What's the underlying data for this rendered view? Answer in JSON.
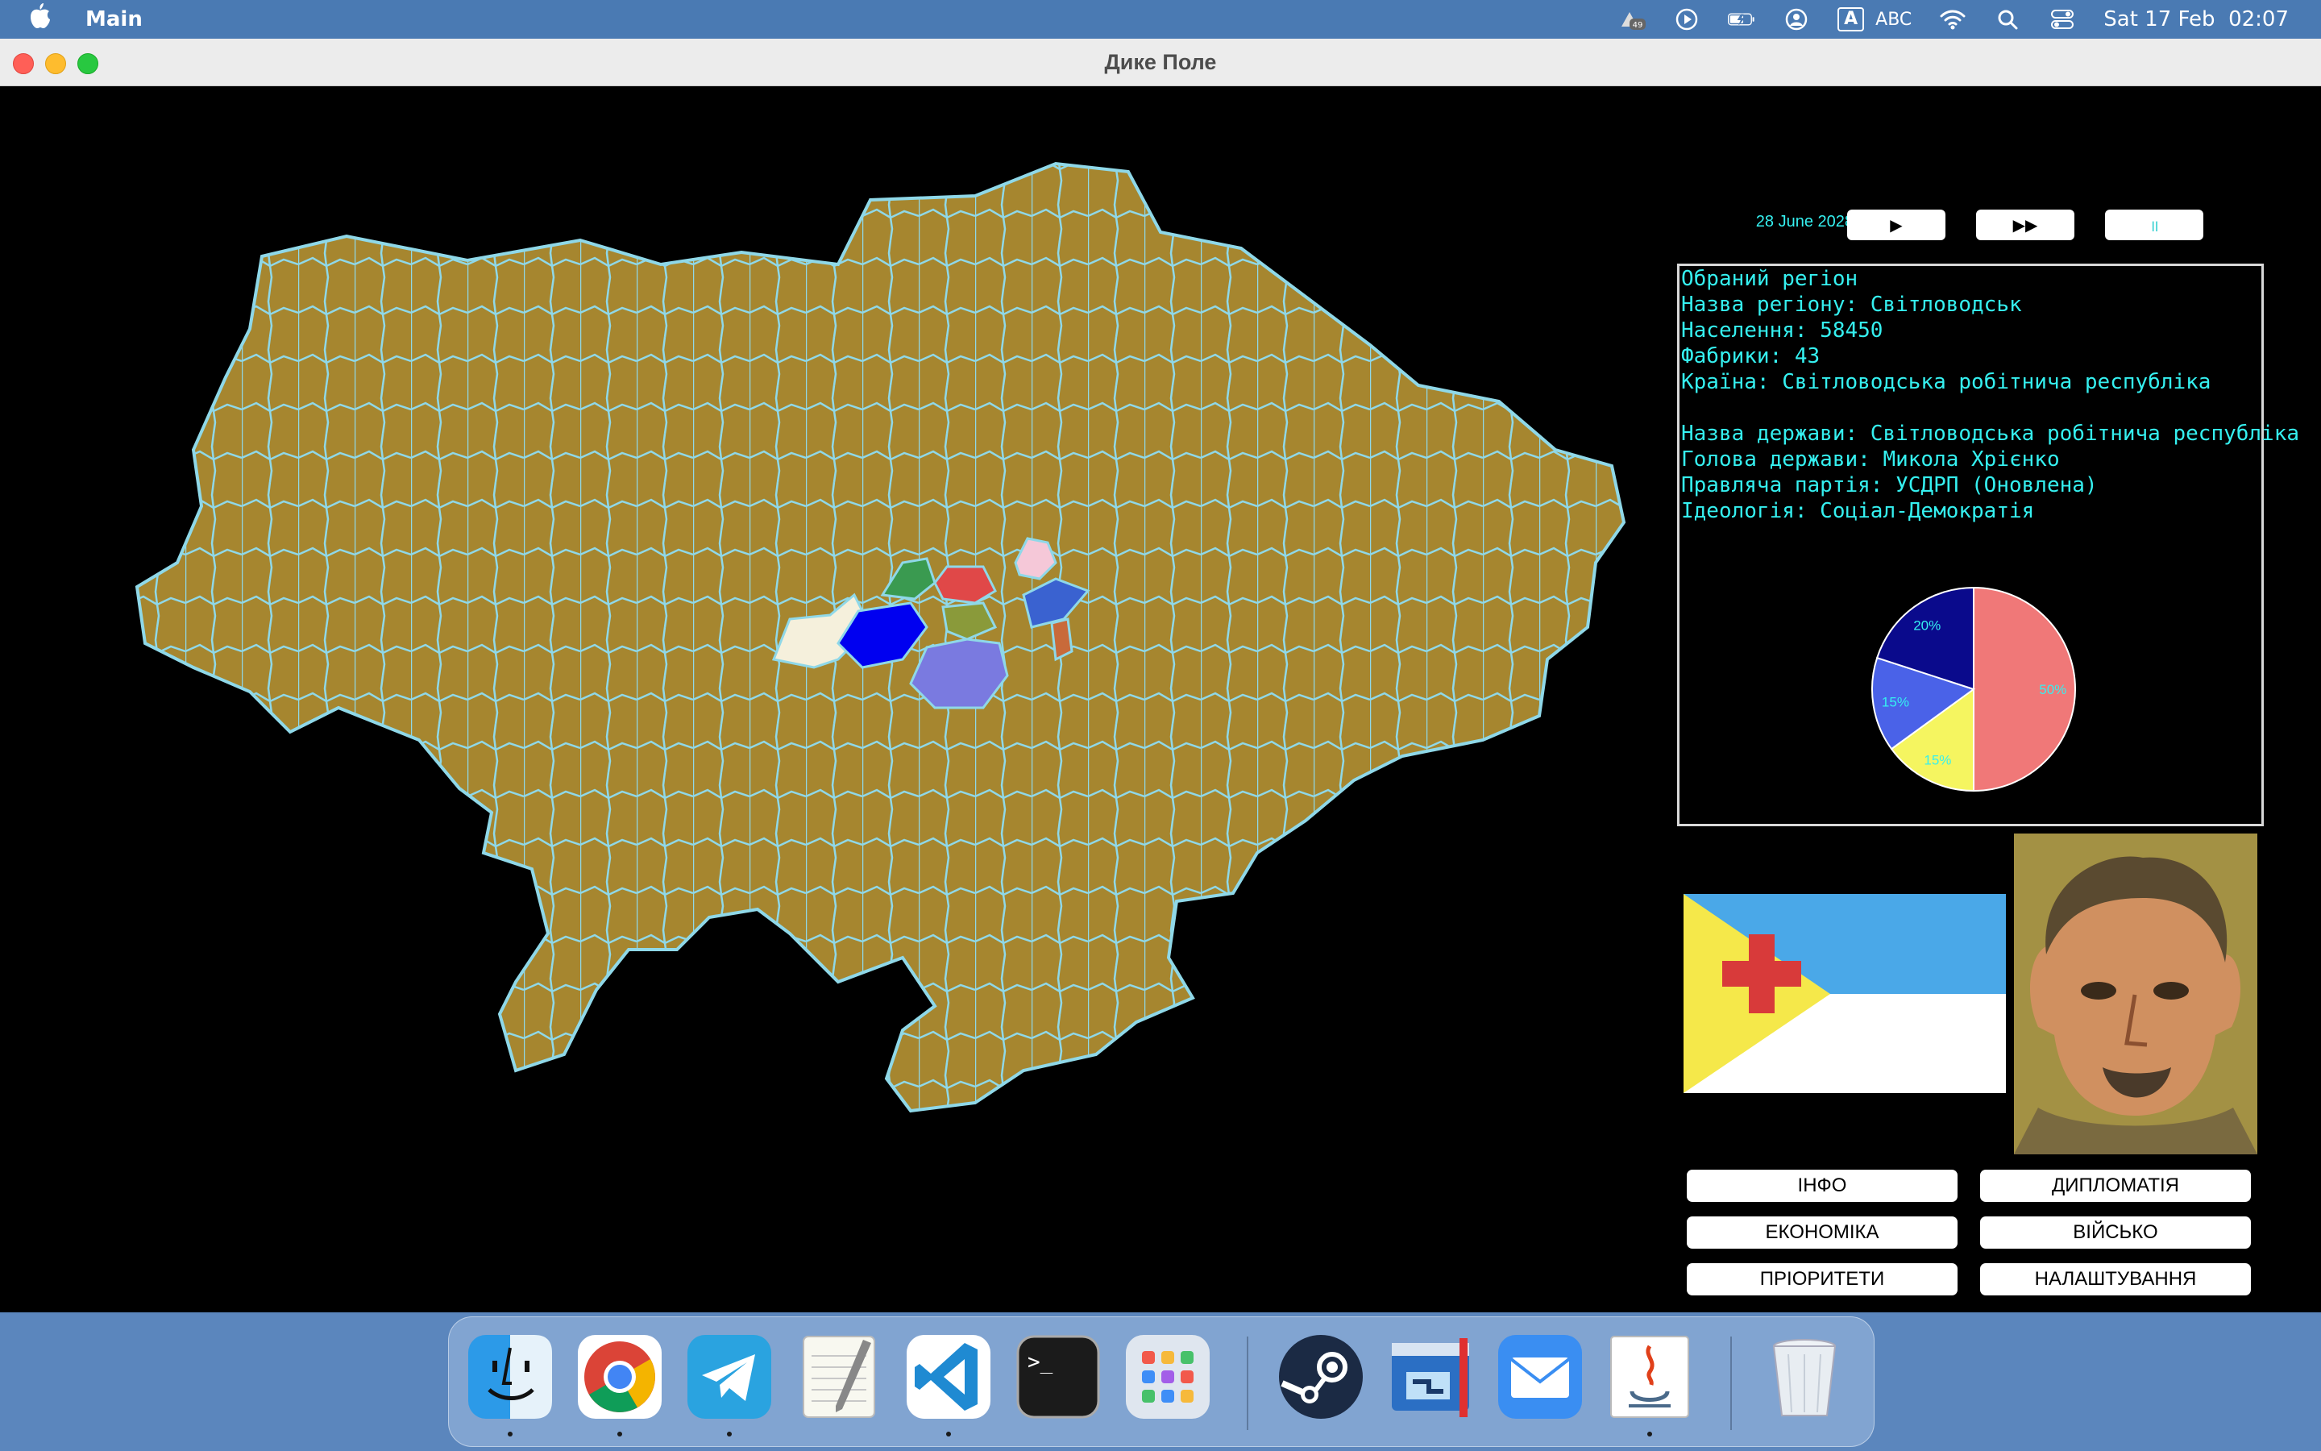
{
  "menubar": {
    "app_name": "Main",
    "badge": "49",
    "input_source": "A",
    "input_label": "ABC",
    "clock": "Sat 17 Feb  02:07"
  },
  "window": {
    "title": "Дике Поле"
  },
  "controls": {
    "date": "28 June 2028",
    "play_label": "▶",
    "fast_label": "▶▶",
    "pause_label": "॥"
  },
  "region": {
    "header": "Обраний регіон",
    "name_line": "Назва регіону: Світловодськ",
    "population_line": "Населення: 58450",
    "factories_line": "Фабрики: 43",
    "country_line": "Країна: Світловодська робітнича республіка"
  },
  "state": {
    "name_line": "Назва держави: Світловодська робітнича республіка",
    "head_line": "Голова держави: Микола Хрієнко",
    "party_line": "Правляча партія: УСДРП (Оновлена)",
    "ideology_line": "Ідеологія: Соціал-Демократія"
  },
  "chart_data": {
    "type": "pie",
    "slices": [
      {
        "value": 50,
        "label": "50%",
        "color": "#f07878"
      },
      {
        "value": 15,
        "label": "15%",
        "color": "#f5f560"
      },
      {
        "value": 15,
        "label": "15%",
        "color": "#4a62e8"
      },
      {
        "value": 20,
        "label": "20%",
        "color": "#0a0a8c"
      }
    ]
  },
  "colors": {
    "map_land": "#a6862f",
    "map_border": "#8fd8e8",
    "label_text": "#35f0f0"
  },
  "menu": {
    "info": "ІНФО",
    "diplomacy": "ДИПЛОМАТІЯ",
    "economy": "ЕКОНОМІКА",
    "military": "ВІЙСЬКО",
    "priorities": "ПРІОРИТЕТИ",
    "settings": "НАЛАШТУВАННЯ"
  },
  "dock": {
    "apps": [
      "finder",
      "chrome",
      "telegram",
      "textedit",
      "vscode",
      "terminal",
      "launchpad",
      "steam",
      "remote-desktop",
      "mail",
      "java",
      "trash"
    ],
    "terminal_prompt": ">_"
  }
}
